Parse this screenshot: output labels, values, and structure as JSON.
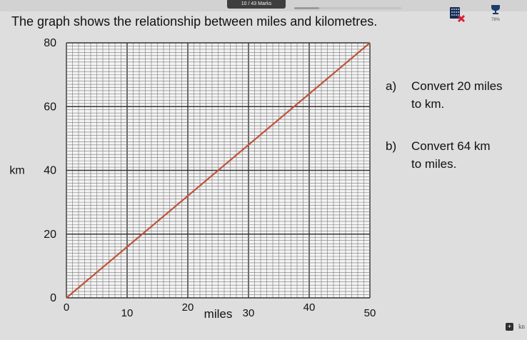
{
  "header": {
    "marks_label": "10 / 43 Marks",
    "progress_fraction": 0.23,
    "trophy_percent": "78%",
    "calculator_icon": "calculator-not-allowed-icon",
    "trophy_icon": "trophy-icon"
  },
  "question": {
    "title": "The graph shows the relationship between miles and kilometres.",
    "part_a": {
      "letter": "a)",
      "lines": [
        "Convert 20 miles",
        "to km."
      ]
    },
    "part_b": {
      "letter": "b)",
      "lines": [
        "Convert 64 km",
        "to miles."
      ]
    }
  },
  "chart_data": {
    "type": "line",
    "xlabel": "miles",
    "ylabel": "km",
    "xlim": [
      0,
      50
    ],
    "ylim": [
      0,
      80
    ],
    "x_ticks": [
      "0",
      "10",
      "20",
      "30",
      "40",
      "50"
    ],
    "y_ticks": [
      "0",
      "20",
      "40",
      "60",
      "80"
    ],
    "minor_grid_x": 2,
    "minor_grid_y": 4,
    "grid": true,
    "line_color": "#c0533a",
    "series": [
      {
        "x": [
          0,
          50
        ],
        "y": [
          0,
          80
        ]
      }
    ]
  },
  "footer": {
    "add_icon": "plus-square-icon",
    "text": "kn"
  }
}
